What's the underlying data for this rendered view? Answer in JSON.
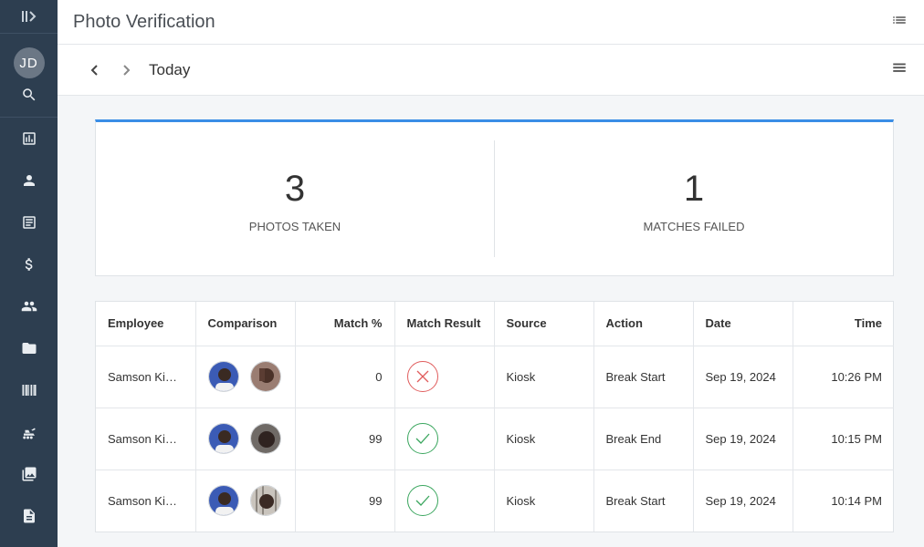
{
  "header": {
    "title": "Photo Verification"
  },
  "subbar": {
    "period": "Today"
  },
  "user": {
    "initials": "JD"
  },
  "stats": [
    {
      "value": "3",
      "label": "PHOTOS TAKEN"
    },
    {
      "value": "1",
      "label": "MATCHES FAILED"
    }
  ],
  "table": {
    "columns": [
      "Employee",
      "Comparison",
      "Match %",
      "Match Result",
      "Source",
      "Action",
      "Date",
      "Time"
    ],
    "rows": [
      {
        "employee": "Samson Kiar...",
        "match": "0",
        "result": "failed",
        "source": "Kiosk",
        "action": "Break Start",
        "date": "Sep 19, 2024",
        "time": "10:26 PM"
      },
      {
        "employee": "Samson Kiar...",
        "match": "99",
        "result": "passed",
        "source": "Kiosk",
        "action": "Break End",
        "date": "Sep 19, 2024",
        "time": "10:15 PM"
      },
      {
        "employee": "Samson Kiar...",
        "match": "99",
        "result": "passed",
        "source": "Kiosk",
        "action": "Break Start",
        "date": "Sep 19, 2024",
        "time": "10:14 PM"
      }
    ]
  },
  "icons": {
    "sidebar": [
      "collapse-icon",
      "search-icon",
      "reports-icon",
      "person-icon",
      "document-icon",
      "dollar-icon",
      "people-icon",
      "folder-icon",
      "barcode-icon",
      "machinery-icon",
      "image-icon",
      "file-icon"
    ],
    "header": "list-icon",
    "subbar": [
      "chevron-left-icon",
      "chevron-right-icon",
      "menu-icon"
    ]
  },
  "colors": {
    "sidebar": "#2d3e50",
    "accent": "#3a8ee6",
    "fail": "#e05c5c",
    "success": "#3aa65e"
  }
}
